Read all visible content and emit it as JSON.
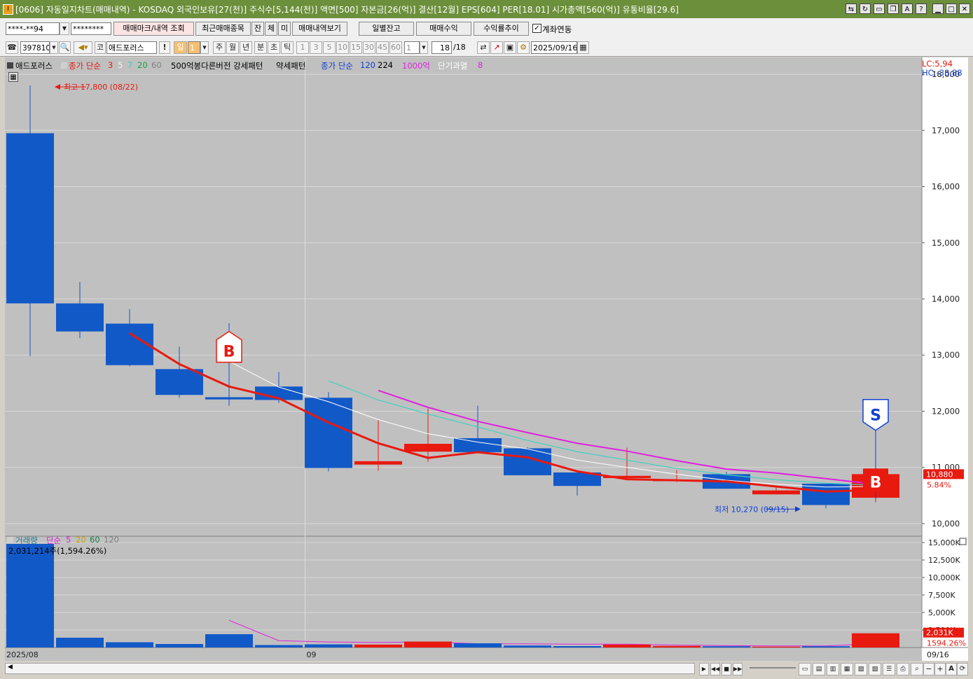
{
  "window": {
    "title": "[0606] 자동일지차트(매매내역) - KOSDAQ 외국인보유[27(천)] 주식수[5,144(천)] 액면[500] 자본금[26(억)] 결산[12월] EPS[604] PER[18.01] 시가총액[560(억)] 유통비율[29.6]"
  },
  "toolbar1": {
    "account": "****-**94",
    "password": "********",
    "btn_mark": "매매마크/내역 조회",
    "btn_recent": "최근매매종목",
    "btn_jan": "잔",
    "btn_che": "체",
    "btn_mi": "미",
    "btn_history": "매매내역보기",
    "btn_daily": "일별잔고",
    "btn_profit": "매매수익",
    "btn_rate": "수익률추이",
    "chk_link": "계좌연동"
  },
  "toolbar2": {
    "code": "397810",
    "market": "코",
    "stock_name": "애드포러스",
    "excl": "!",
    "period_selected": "일",
    "period_value": "1",
    "periods": [
      "주",
      "월",
      "년",
      "분",
      "초",
      "틱"
    ],
    "intervals": [
      "1",
      "3",
      "5",
      "10",
      "15",
      "30",
      "45",
      "60"
    ],
    "interval_value": "1",
    "count": "18",
    "count_total": "/18",
    "date": "2025/09/16"
  },
  "legend": {
    "name": "애드포러스",
    "close_simple": "종가 단순",
    "ma3": "3",
    "ma5": "5",
    "ma7": "7",
    "ma20": "20",
    "ma60": "60",
    "pattern": "500억봉다른버전 강세패턴",
    "weak": "약세패턴",
    "close_simple2": "종가 단순",
    "ma120": "120",
    "ma224": "224",
    "line1000": "1000억",
    "overheat": "단기과열",
    "overheat_val": "8"
  },
  "vol_legend": {
    "label": "거래량",
    "simple": "단순",
    "v5": "5",
    "v20": "20",
    "v60": "60",
    "v120": "120",
    "value_line": "2,031,214주(1,594.26%)"
  },
  "annotations": {
    "high_label": "최고 17,800 (08/22)",
    "low_label": "최저 10,270 (09/15)",
    "lc": "LC:5,94",
    "hc": "HC:-38,88",
    "current_price": "10,880",
    "current_pct": "5.84%",
    "vol_current": "2,031K",
    "vol_pct": "1594.26%",
    "marker_b": "B",
    "marker_s": "S"
  },
  "price_axis": [
    "18,000",
    "17,000",
    "16,000",
    "15,000",
    "14,000",
    "13,000",
    "12,000",
    "11,000",
    "10,000"
  ],
  "vol_axis": [
    "15,000K",
    "12,500K",
    "10,000K",
    "7,500K",
    "5,000K",
    "2,500K"
  ],
  "date_axis": {
    "start": "2025/08",
    "sep": "09",
    "end": "09/16"
  },
  "colors": {
    "up": "#e8190f",
    "down": "#1259c8",
    "ma3": "#e8190f",
    "ma5": "#ffffff",
    "ma7": "#40d0c0",
    "ma1000": "#e020e0"
  },
  "chart_data": {
    "type": "candlestick",
    "candles": [
      {
        "o": 16950,
        "h": 17800,
        "l": 12980,
        "c": 13920
      },
      {
        "o": 13920,
        "h": 14300,
        "l": 13300,
        "c": 13420
      },
      {
        "o": 13560,
        "h": 13820,
        "l": 12800,
        "c": 12820
      },
      {
        "o": 12750,
        "h": 13150,
        "l": 12240,
        "c": 12290
      },
      {
        "o": 12250,
        "h": 13570,
        "l": 12100,
        "c": 12210
      },
      {
        "o": 12440,
        "h": 12700,
        "l": 12150,
        "c": 12200
      },
      {
        "o": 12240,
        "h": 12340,
        "l": 10930,
        "c": 10990
      },
      {
        "o": 11050,
        "h": 11840,
        "l": 10940,
        "c": 11110
      },
      {
        "o": 11280,
        "h": 12050,
        "l": 11100,
        "c": 11420
      },
      {
        "o": 11520,
        "h": 12100,
        "l": 11290,
        "c": 11270
      },
      {
        "o": 11340,
        "h": 11360,
        "l": 10870,
        "c": 10860
      },
      {
        "o": 10910,
        "h": 10910,
        "l": 10500,
        "c": 10670
      },
      {
        "o": 10810,
        "h": 11350,
        "l": 10780,
        "c": 10850
      },
      {
        "o": 10760,
        "h": 10950,
        "l": 10740,
        "c": 10780
      },
      {
        "o": 10880,
        "h": 10920,
        "l": 10620,
        "c": 10620
      },
      {
        "o": 10520,
        "h": 10660,
        "l": 10520,
        "c": 10590
      },
      {
        "o": 10710,
        "h": 10720,
        "l": 10270,
        "c": 10330
      },
      {
        "o": 10460,
        "h": 10950,
        "l": 10380,
        "c": 10880
      }
    ],
    "volume_k": [
      14800,
      1400,
      750,
      500,
      1900,
      350,
      450,
      420,
      850,
      600,
      280,
      200,
      420,
      220,
      180,
      120,
      180,
      2031
    ],
    "ma3": [
      null,
      null,
      13390,
      12840,
      12440,
      12230,
      11800,
      11430,
      11170,
      11270,
      11180,
      10930,
      10790,
      10770,
      10750,
      10660,
      10570,
      10600
    ],
    "ma5": [
      null,
      null,
      null,
      null,
      12890,
      12430,
      12170,
      11850,
      11600,
      11450,
      11330,
      11130,
      11000,
      10880,
      10770,
      10700,
      10650,
      10660
    ],
    "ma7": [
      null,
      null,
      null,
      null,
      null,
      null,
      12540,
      12200,
      11950,
      11720,
      11480,
      11280,
      11130,
      10980,
      10870,
      10780,
      10720,
      10680
    ],
    "ma1000": [
      null,
      null,
      null,
      null,
      null,
      null,
      null,
      12370,
      12070,
      11820,
      11620,
      11430,
      11290,
      11120,
      10970,
      10900,
      10800,
      10700
    ],
    "vol_ma5": [
      null,
      null,
      null,
      null,
      3880,
      980,
      790,
      720,
      800,
      540,
      520,
      470,
      470,
      340,
      260,
      230,
      220,
      550
    ],
    "ylim": [
      9800,
      18300
    ],
    "vol_ylim": [
      0,
      15500
    ]
  }
}
